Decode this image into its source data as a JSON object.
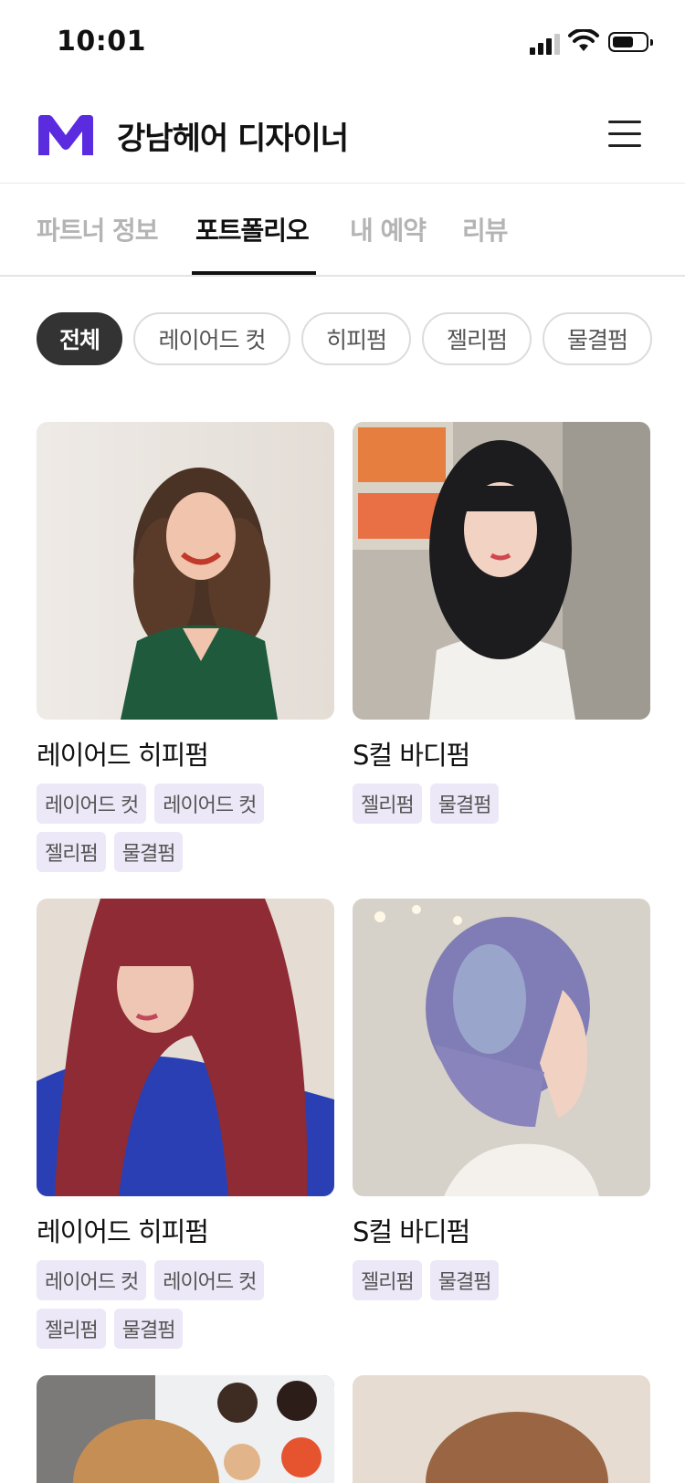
{
  "status_bar": {
    "time": "10:01"
  },
  "header": {
    "brand": "강남헤어 디자이너",
    "logo_color": "#5b2be0"
  },
  "tabs": [
    {
      "label": "파트너 정보",
      "active": false
    },
    {
      "label": "포트폴리오",
      "active": true
    },
    {
      "label": "내 예약",
      "active": false
    },
    {
      "label": "리뷰",
      "active": false
    }
  ],
  "filters": [
    {
      "label": "전체",
      "active": true
    },
    {
      "label": "레이어드 컷",
      "active": false
    },
    {
      "label": "히피펌",
      "active": false
    },
    {
      "label": "젤리펌",
      "active": false
    },
    {
      "label": "물결펌",
      "active": false
    }
  ],
  "portfolio": [
    {
      "title": "레이어드 히피펌",
      "tags": [
        "레이어드 컷",
        "레이어드 컷",
        "젤리펌",
        "물결펌"
      ],
      "image": "curly-brown-hair-green-sweater"
    },
    {
      "title": "S컬 바디펌",
      "tags": [
        "젤리펌",
        "물결펌"
      ],
      "image": "long-black-wavy-hair-white-tee"
    },
    {
      "title": "레이어드 히피펌",
      "tags": [
        "레이어드 컷",
        "레이어드 컷",
        "젤리펌",
        "물결펌"
      ],
      "image": "long-red-hair-blue-top"
    },
    {
      "title": "S컬 바디펌",
      "tags": [
        "젤리펌",
        "물결펌"
      ],
      "image": "lavender-bob-hair"
    },
    {
      "title": "",
      "tags": [],
      "image": "blonde-hair-photo-wall"
    },
    {
      "title": "",
      "tags": [],
      "image": "brown-hair-beige-wall"
    }
  ],
  "accent_colors": {
    "tag_bg": "#ece8f7",
    "active_chip": "#333333"
  }
}
